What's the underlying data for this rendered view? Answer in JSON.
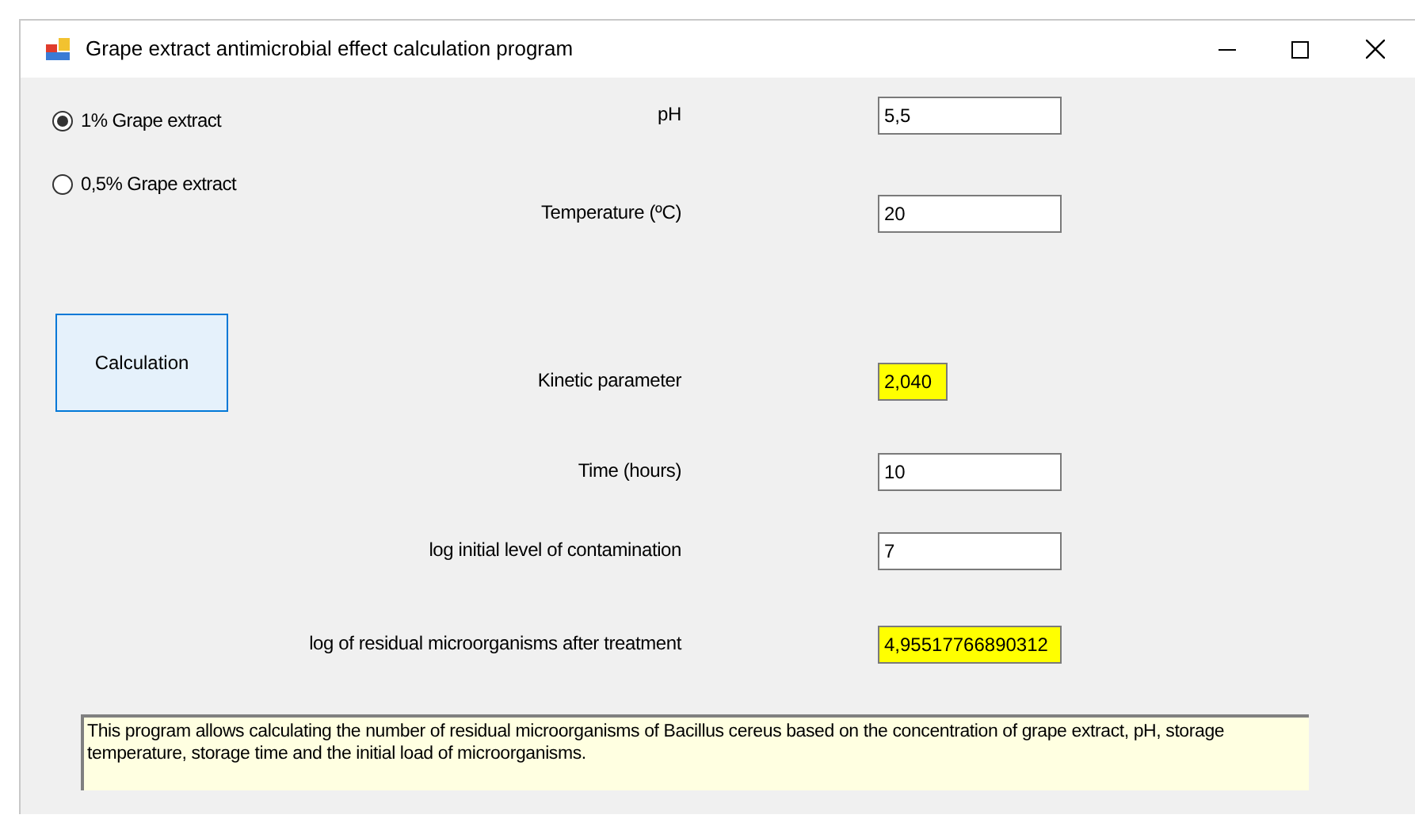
{
  "window": {
    "title": "Grape extract antimicrobial effect calculation program"
  },
  "options": [
    {
      "label": "1% Grape extract",
      "selected": true
    },
    {
      "label": "0,5% Grape extract",
      "selected": false
    }
  ],
  "calculate_button": "Calculation",
  "fields": [
    {
      "label": "pH",
      "value": "5,5",
      "kind": "input"
    },
    {
      "label": "Temperature (ºC)",
      "value": "20",
      "kind": "input"
    },
    {
      "label": "Kinetic parameter",
      "value": "2,040",
      "kind": "output"
    },
    {
      "label": "Time (hours)",
      "value": "10",
      "kind": "input"
    },
    {
      "label": "log initial level of contamination",
      "value": "7",
      "kind": "input"
    },
    {
      "label": "log of residual microorganisms after treatment",
      "value": "4,95517766890312",
      "kind": "result"
    }
  ],
  "description": "This program allows calculating the number of residual microorganisms of Bacillus cereus based on the concentration of grape extract, pH, storage temperature, storage time and the initial load of microorganisms."
}
